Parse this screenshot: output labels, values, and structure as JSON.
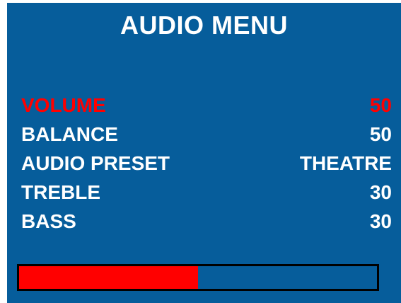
{
  "menu": {
    "title": "AUDIO MENU",
    "items": [
      {
        "label": "VOLUME",
        "value": "50",
        "selected": true
      },
      {
        "label": "BALANCE",
        "value": "50",
        "selected": false
      },
      {
        "label": "AUDIO PRESET",
        "value": "THEATRE",
        "selected": false
      },
      {
        "label": "TREBLE",
        "value": "30",
        "selected": false
      },
      {
        "label": "BASS",
        "value": "30",
        "selected": false
      }
    ]
  },
  "level_bar": {
    "percent": 50,
    "fill_color": "#ff0000",
    "track_color": "#065d9b"
  },
  "colors": {
    "background": "#065d9b",
    "text": "#ffffff",
    "selected_text": "#ff0000"
  }
}
